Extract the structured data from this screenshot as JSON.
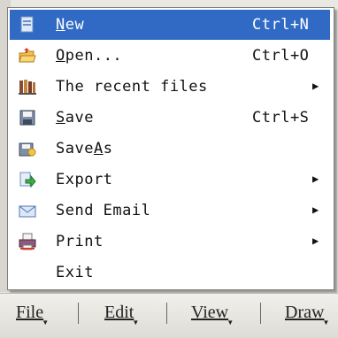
{
  "menu": {
    "items": [
      {
        "pre": "",
        "key": "N",
        "post": "ew",
        "shortcut": "Ctrl+N",
        "icon": "new-file-icon",
        "submenu": false,
        "highlighted": true
      },
      {
        "pre": "",
        "key": "O",
        "post": "pen...",
        "shortcut": "Ctrl+O",
        "icon": "open-folder-icon",
        "submenu": false,
        "highlighted": false
      },
      {
        "pre": "The recent files",
        "key": "",
        "post": "",
        "shortcut": "",
        "icon": "recent-files-icon",
        "submenu": true,
        "highlighted": false
      },
      {
        "pre": "",
        "key": "S",
        "post": "ave",
        "shortcut": "Ctrl+S",
        "icon": "save-icon",
        "submenu": false,
        "highlighted": false
      },
      {
        "pre": "Save",
        "key": "A",
        "post": "s",
        "shortcut": "",
        "icon": "save-as-icon",
        "submenu": false,
        "highlighted": false
      },
      {
        "pre": "Export",
        "key": "",
        "post": "",
        "shortcut": "",
        "icon": "export-icon",
        "submenu": true,
        "highlighted": false
      },
      {
        "pre": "Send Email",
        "key": "",
        "post": "",
        "shortcut": "",
        "icon": "email-icon",
        "submenu": true,
        "highlighted": false
      },
      {
        "pre": "Print",
        "key": "",
        "post": "",
        "shortcut": "",
        "icon": "print-icon",
        "submenu": true,
        "highlighted": false
      },
      {
        "pre": "Exit",
        "key": "",
        "post": "",
        "shortcut": "",
        "icon": "",
        "submenu": false,
        "highlighted": false
      }
    ],
    "submenu_arrow": "▶"
  },
  "menubar": {
    "items": [
      "File",
      "Edit",
      "View",
      "Draw"
    ]
  },
  "colors": {
    "highlight": "#316ac5",
    "menu_bg": "#ffffff",
    "menubar_bg": "#e9e8e3"
  }
}
